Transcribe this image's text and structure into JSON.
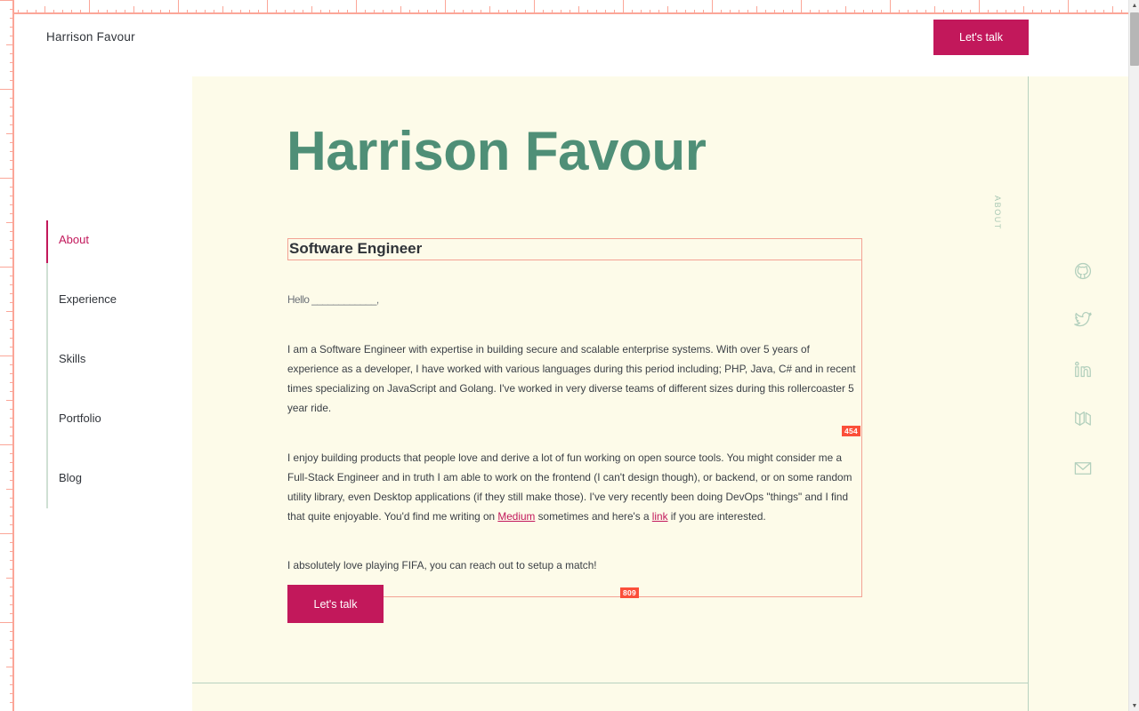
{
  "header": {
    "brand": "Harrison Favour",
    "cta_label": "Let's talk"
  },
  "sidebar": {
    "active": "About",
    "items": [
      {
        "label": "About"
      },
      {
        "label": "Experience"
      },
      {
        "label": "Skills"
      },
      {
        "label": "Portfolio"
      },
      {
        "label": "Blog"
      }
    ]
  },
  "main": {
    "hero_title": "Harrison Favour",
    "role": "Software Engineer",
    "greeting": "Hello ____________,",
    "paragraph_1": "I am a Software Engineer with expertise in building secure and scalable enterprise systems. With over 5 years of experience as a developer, I have worked with various languages during this period including; PHP, Java, C# and in recent times specializing on JavaScript and Golang. I've worked in very diverse teams of different sizes during this rollercoaster 5 year ride.",
    "paragraph_2_part1": "I enjoy building products that people love and derive a lot of fun working on open source tools. You might consider me a Full-Stack Engineer and in truth I am able to work on the frontend (I can't design though), or backend, or on some random utility library, even Desktop applications (if they still make those). I've very recently been doing DevOps \"things\" and I find that quite enjoyable. You'd find me writing on ",
    "paragraph_2_link1": "Medium",
    "paragraph_2_part2": " sometimes and here's a ",
    "paragraph_2_link2": "link",
    "paragraph_2_part3": " if you are interested.",
    "paragraph_3": "I absolutely love playing FIFA, you can reach out to setup a match!",
    "cta_label": "Let's talk",
    "section_label": "ABOUT"
  },
  "measurements": {
    "height_badge": "454",
    "width_badge": "809"
  },
  "socials": [
    {
      "name": "github-icon",
      "title": "GitHub"
    },
    {
      "name": "twitter-icon",
      "title": "Twitter"
    },
    {
      "name": "linkedin-icon",
      "title": "LinkedIn"
    },
    {
      "name": "medium-icon",
      "title": "Medium"
    },
    {
      "name": "email-icon",
      "title": "Email"
    }
  ],
  "colors": {
    "accent_pink": "#c2185b",
    "heading_green": "#4f8f77",
    "panel_cream": "#fdfbe9",
    "guide_salmon": "#f3a294",
    "badge_red": "#fb4f3a",
    "rule_sage": "#b8d2c0"
  },
  "scrollbar": {
    "up_arrow": "▲",
    "down_arrow": "▼"
  }
}
